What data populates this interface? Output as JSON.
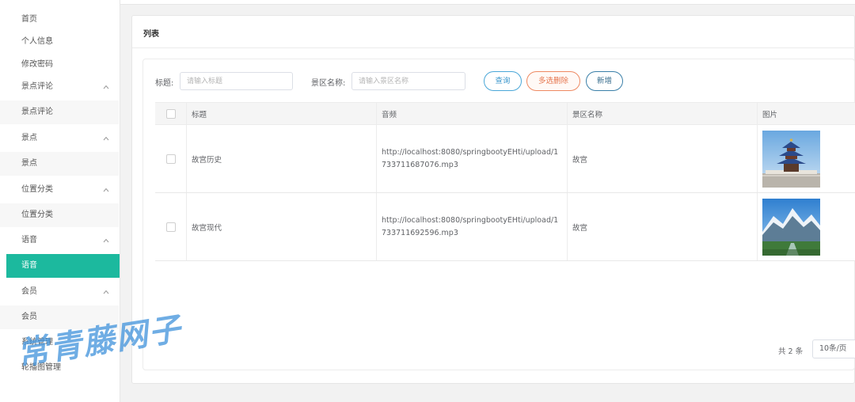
{
  "sidebar": {
    "items": [
      {
        "label": "首页",
        "type": "link"
      },
      {
        "label": "个人信息",
        "type": "link"
      },
      {
        "label": "修改密码",
        "type": "link"
      },
      {
        "label": "景点评论",
        "type": "group"
      },
      {
        "label": "景点评论",
        "type": "sub"
      },
      {
        "label": "景点",
        "type": "group"
      },
      {
        "label": "景点",
        "type": "sub"
      },
      {
        "label": "位置分类",
        "type": "group"
      },
      {
        "label": "位置分类",
        "type": "sub"
      },
      {
        "label": "语音",
        "type": "group"
      },
      {
        "label": "语音",
        "type": "sub-active"
      },
      {
        "label": "会员",
        "type": "group"
      },
      {
        "label": "会员",
        "type": "sub"
      },
      {
        "label": "系统管理",
        "type": "group"
      },
      {
        "label": "轮播图管理",
        "type": "sub"
      }
    ]
  },
  "card": {
    "title": "列表"
  },
  "filters": {
    "title_label": "标题:",
    "title_placeholder": "请输入标题",
    "scenic_label": "景区名称:",
    "scenic_placeholder": "请输入景区名称"
  },
  "buttons": {
    "query": "查询",
    "batch_delete": "多选删除",
    "add": "新增"
  },
  "table": {
    "headers": [
      "标题",
      "音频",
      "景区名称",
      "图片"
    ],
    "rows": [
      {
        "title": "故宫历史",
        "audio": "http://localhost:8080/springbootyEHti/upload/1733711687076.mp3",
        "scenic": "故宫",
        "image": "pagoda-photo"
      },
      {
        "title": "故宫现代",
        "audio": "http://localhost:8080/springbootyEHti/upload/1733711692596.mp3",
        "scenic": "故宫",
        "image": "mountain-photo"
      }
    ]
  },
  "pager": {
    "total": "共 2 条",
    "page_size": "10条/页"
  },
  "watermark": "常青藤网子",
  "colors": {
    "accent": "#1cb99e",
    "query": "#3b97cc",
    "delete": "#e6754d",
    "add": "#3a6f8f"
  }
}
